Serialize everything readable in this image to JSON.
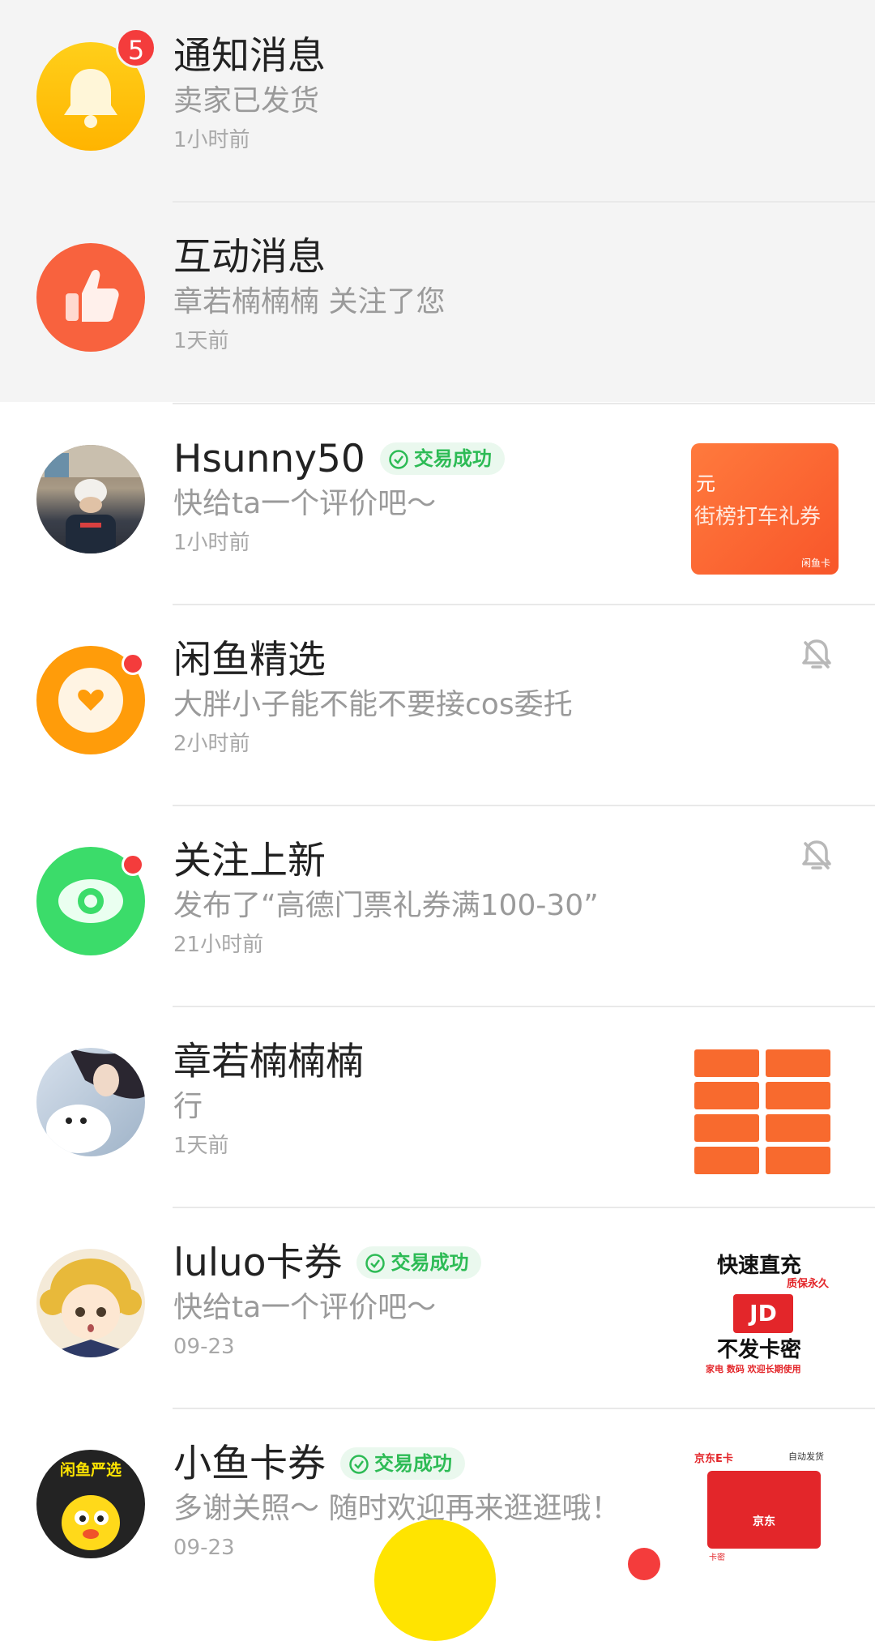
{
  "conversations": [
    {
      "title": "通知消息",
      "subtitle": "卖家已发货",
      "time": "1小时前",
      "badge": "5",
      "icon": "bell-icon"
    },
    {
      "title": "互动消息",
      "subtitle": "章若楠楠楠 关注了您",
      "time": "1天前",
      "icon": "thumbs-up-icon"
    },
    {
      "title": "Hsunny50",
      "tag": "交易成功",
      "subtitle": "快给ta一个评价吧～",
      "time": "1小时前",
      "thumb": {
        "line1": "元",
        "line2": "街榜打车礼券",
        "corner": "闲鱼卡"
      }
    },
    {
      "title": "闲鱼精选",
      "subtitle": "大胖小子能不能不要接cos委托",
      "time": "2小时前",
      "icon": "heart-icon",
      "muted": true
    },
    {
      "title": "关注上新",
      "subtitle": "发布了“高德门票礼券满100-30”",
      "time": "21小时前",
      "icon": "eye-icon",
      "muted": true
    },
    {
      "title": "章若楠楠楠",
      "subtitle": "行",
      "time": "1天前"
    },
    {
      "title": "luluo卡券",
      "tag": "交易成功",
      "subtitle": "快给ta一个评价吧～",
      "time": "09-23",
      "thumb": {
        "top": "快速直充",
        "guarantee": "质保永久",
        "bottom": "不发卡密",
        "foot": "家电 数码 欢迎长期使用",
        "logo": "JD"
      }
    },
    {
      "title": "小鱼卡券",
      "tag": "交易成功",
      "subtitle": "多谢关照～ 随时欢迎再来逛逛哦！",
      "time": "09-23",
      "avatar_text": "闲鱼严选",
      "thumb": {
        "left": "京东E卡",
        "right": "自动发货",
        "brand": "京东",
        "foot": "卡密"
      }
    }
  ],
  "colors": {
    "accent_yellow": "#ffe400",
    "success_green": "#2dbb55",
    "badge_red": "#f43c3c"
  }
}
